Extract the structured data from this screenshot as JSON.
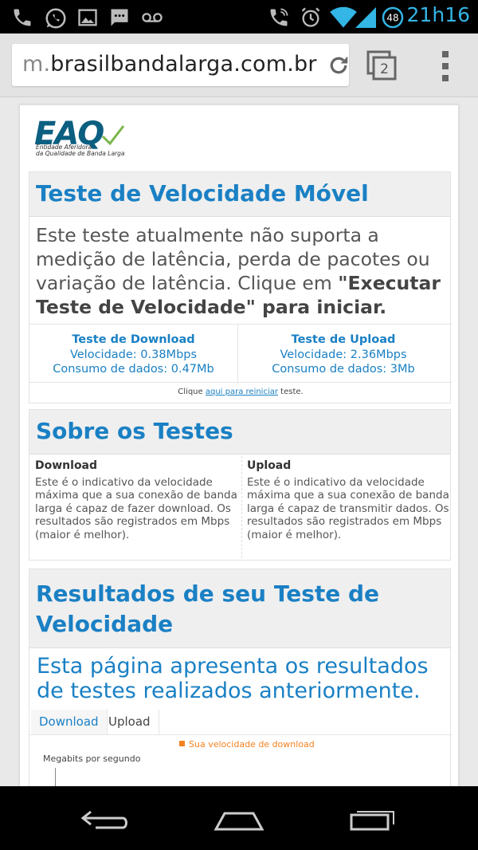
{
  "status_bar": {
    "time": "21h16",
    "battery_level": "48",
    "left_icons": [
      "phone-icon",
      "whatsapp-icon",
      "image-icon",
      "message-icon",
      "voicemail-icon"
    ],
    "right_icons": [
      "phone-call-icon",
      "alarm-icon",
      "wifi-icon",
      "signal-icon",
      "battery-icon"
    ]
  },
  "browser": {
    "url_scheme": "m.",
    "url_host": "brasilbandalarga.com.br",
    "tab_count": "2"
  },
  "logo": {
    "main": "EAQ",
    "sub_line1": "Entidade Aferidora",
    "sub_line2": "da Qualidade de Banda Larga"
  },
  "speed_test": {
    "title": "Teste de Velocidade Móvel",
    "intro_plain": "Este teste atualmente não suporta a medição de latência, perda de pacotes ou variação de latência. Clique em ",
    "intro_bold": "\"Executar Teste de Velocidade\" para iniciar.",
    "download": {
      "title": "Teste de Download",
      "speed": "Velocidade: 0.38Mbps",
      "data": "Consumo de dados: 0.47Mb"
    },
    "upload": {
      "title": "Teste de Upload",
      "speed": "Velocidade: 2.36Mbps",
      "data": "Consumo de dados: 3Mb"
    },
    "restart_prefix": "Clique ",
    "restart_link": "aqui para reiniciar",
    "restart_suffix": " teste."
  },
  "about": {
    "title": "Sobre os Testes",
    "download_heading": "Download",
    "download_text": "Este é o indicativo da velocidade máxima que a sua conexão de banda larga é capaz de fazer download. Os resultados são registrados em Mbps (maior é melhor).",
    "upload_heading": "Upload",
    "upload_text": "Este é o indicativo da velocidade máxima que a sua conexão de banda larga é capaz de transmitir dados. Os resultados são registrados em Mbps (maior é melhor)."
  },
  "results": {
    "title": "Resultados de seu Teste de Velocidade",
    "description": "Esta página apresenta os resultados de testes realizados anteriormente.",
    "tabs": [
      "Download",
      "Upload"
    ],
    "legend": "Sua velocidade de download",
    "ylabel": "Megabits por segundo"
  },
  "colors": {
    "accent": "#1a80c4",
    "status_blue": "#33b5e5",
    "legend_orange": "#f58220"
  }
}
